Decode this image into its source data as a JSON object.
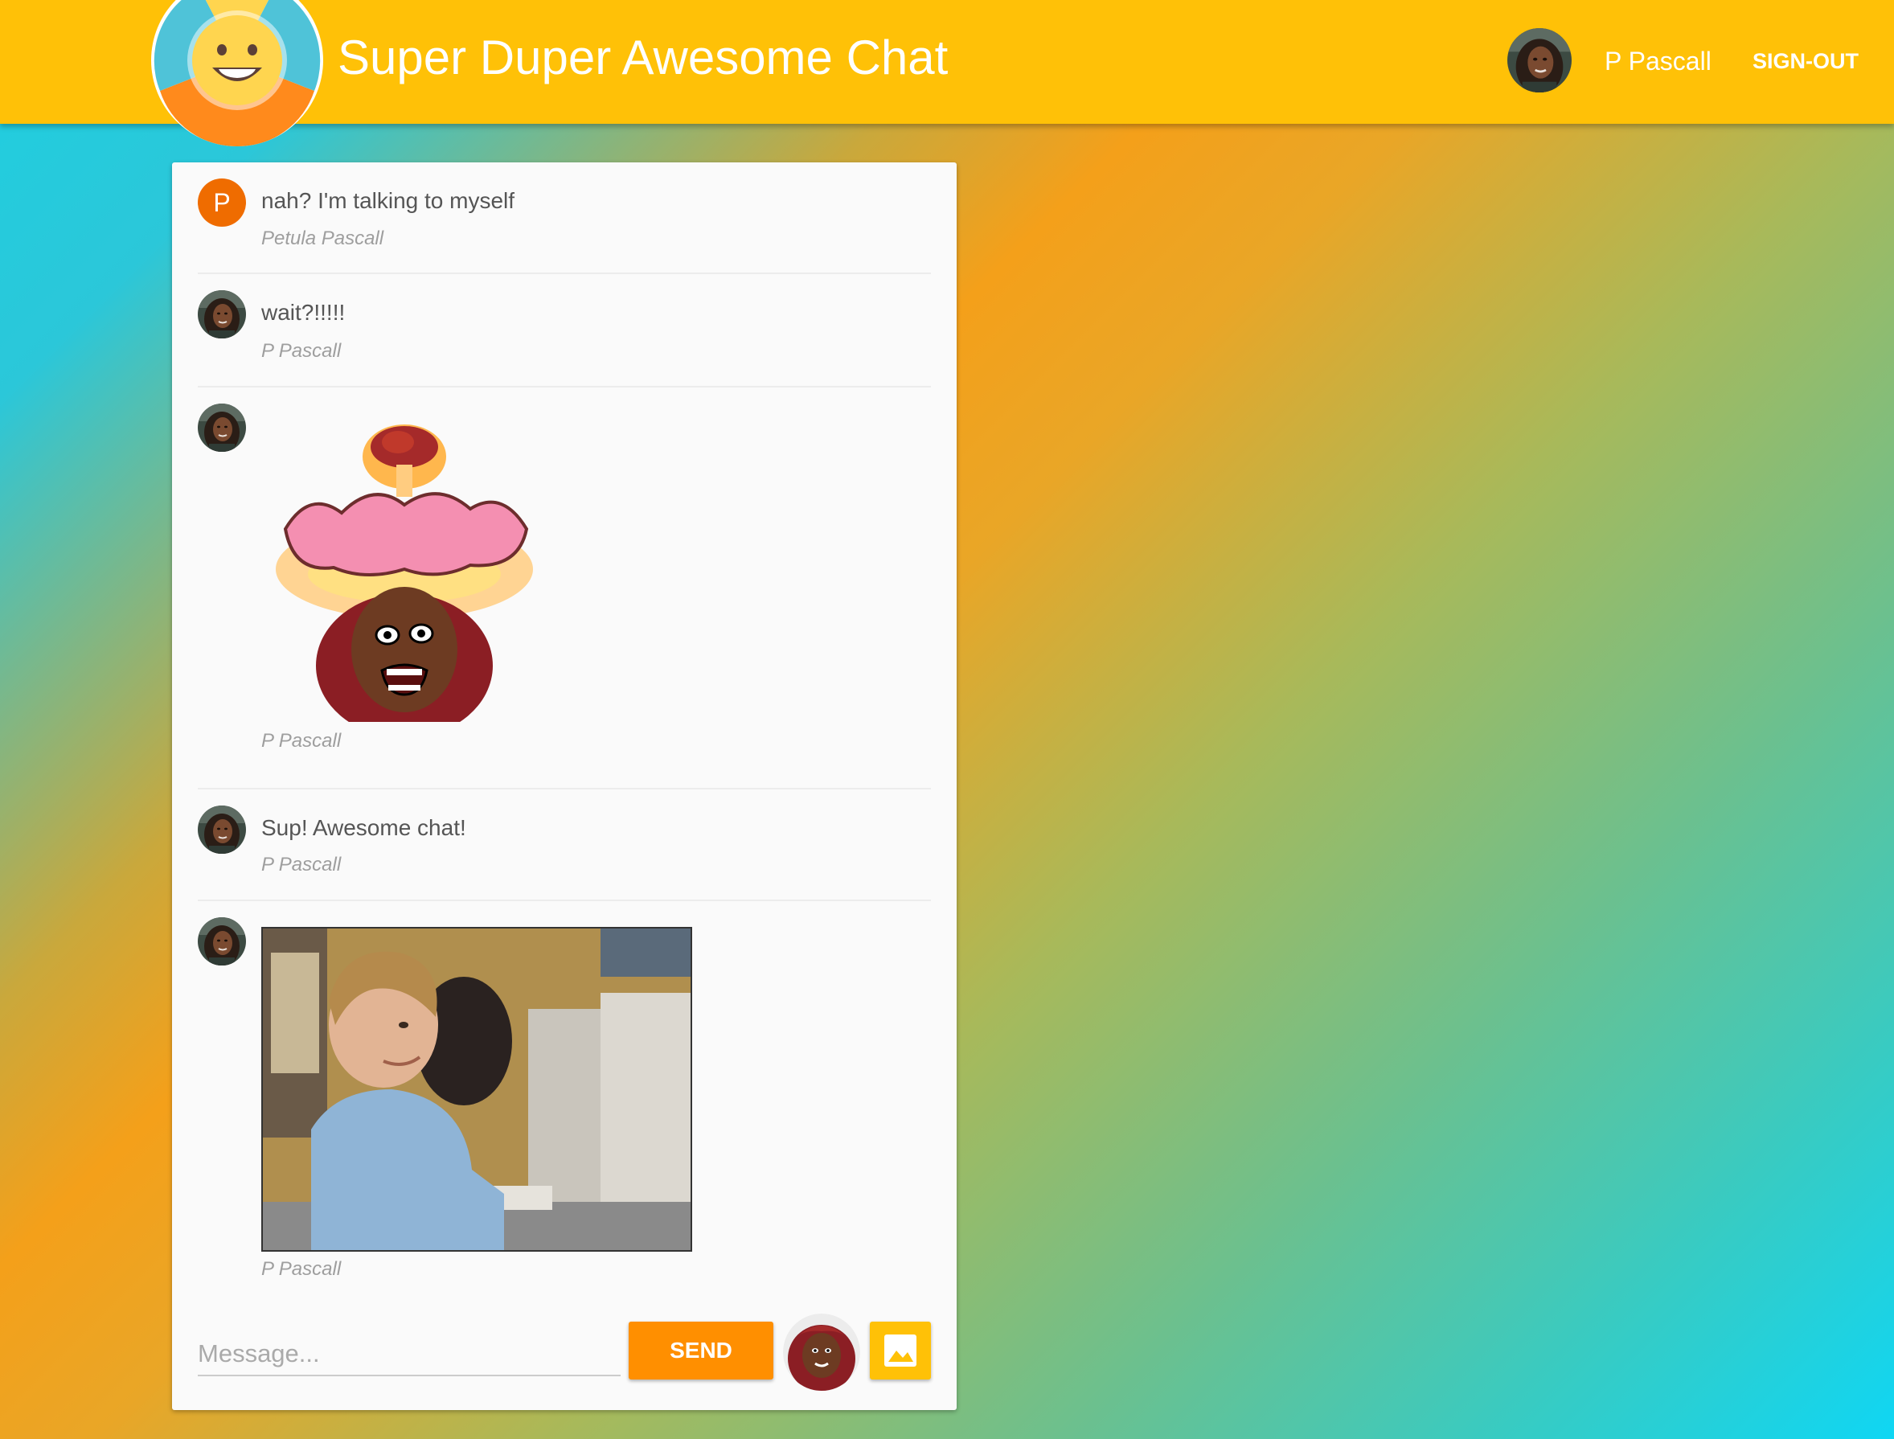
{
  "header": {
    "title": "Super Duper Awesome Chat",
    "user_name": "P Pascall",
    "signout_label": "SIGN-OUT",
    "logo_icon": "smiley-face-icon",
    "background_color": "#ffc107"
  },
  "messages": [
    {
      "avatar_letter": "P",
      "avatar_color": "#ef6c00",
      "text": "nah? I'm talking to myself",
      "author": "Petula Pascall"
    },
    {
      "avatar": "user-photo",
      "text": "wait?!!!!!",
      "author": "P Pascall"
    },
    {
      "avatar": "user-photo",
      "image": "mind-blown-bitmoji-sticker",
      "author": "P Pascall"
    },
    {
      "avatar": "user-photo",
      "text": "Sup! Awesome chat!",
      "author": "P Pascall"
    },
    {
      "avatar": "user-photo",
      "image": "boy-at-computer-gif",
      "author": "P Pascall"
    }
  ],
  "composer": {
    "placeholder": "Message...",
    "send_label": "SEND",
    "send_color": "#ff8f00",
    "bitmoji_icon": "bitmoji-avatar-icon",
    "image_icon": "image-icon"
  }
}
